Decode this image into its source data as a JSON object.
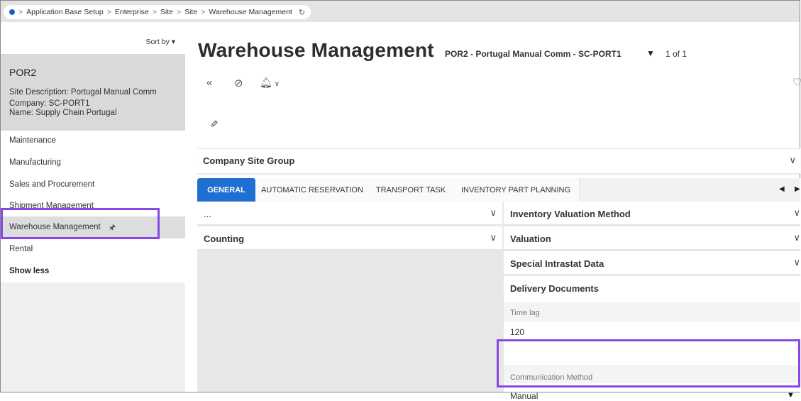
{
  "breadcrumb": {
    "items": [
      "Application Base Setup",
      "Enterprise",
      "Site",
      "Site",
      "Warehouse Management"
    ],
    "separator": ">"
  },
  "sidebar": {
    "sort_label": "Sort by",
    "record": {
      "title": "POR2",
      "site_description": "Site Description:  Portugal Manual Comm",
      "company": "Company:  SC-PORT1",
      "name": "Name:  Supply Chain Portugal"
    },
    "nav": [
      {
        "label": "Maintenance"
      },
      {
        "label": "Manufacturing"
      },
      {
        "label": "Sales and Procurement"
      },
      {
        "label": "Shipment Management"
      },
      {
        "label": "Warehouse Management",
        "active": true
      },
      {
        "label": "Rental"
      }
    ],
    "show_less": "Show less"
  },
  "header": {
    "title": "Warehouse Management",
    "record_subtitle": "POR2 - Portugal Manual Comm - SC-PORT1",
    "record_counter": "1 of 1"
  },
  "company_site_group": {
    "label": "Company Site Group"
  },
  "tabs": [
    {
      "label": "GENERAL",
      "active": true
    },
    {
      "label": "AUTOMATIC RESERVATION"
    },
    {
      "label": "TRANSPORT TASK"
    },
    {
      "label": "INVENTORY PART PLANNING"
    }
  ],
  "left_groups": [
    {
      "label": "..."
    },
    {
      "label": "Counting"
    }
  ],
  "right_groups": [
    {
      "label": "Inventory Valuation Method"
    },
    {
      "label": "Valuation"
    },
    {
      "label": "Special Intrastat Data"
    },
    {
      "label": "Delivery Documents"
    }
  ],
  "fields": {
    "time_lag_label": "Time lag",
    "time_lag_value": "120",
    "comm_method_label": "Communication Method",
    "comm_method_value": "Manual"
  },
  "colors": {
    "accent": "#1e6fd1",
    "highlight": "#8a46e6"
  }
}
